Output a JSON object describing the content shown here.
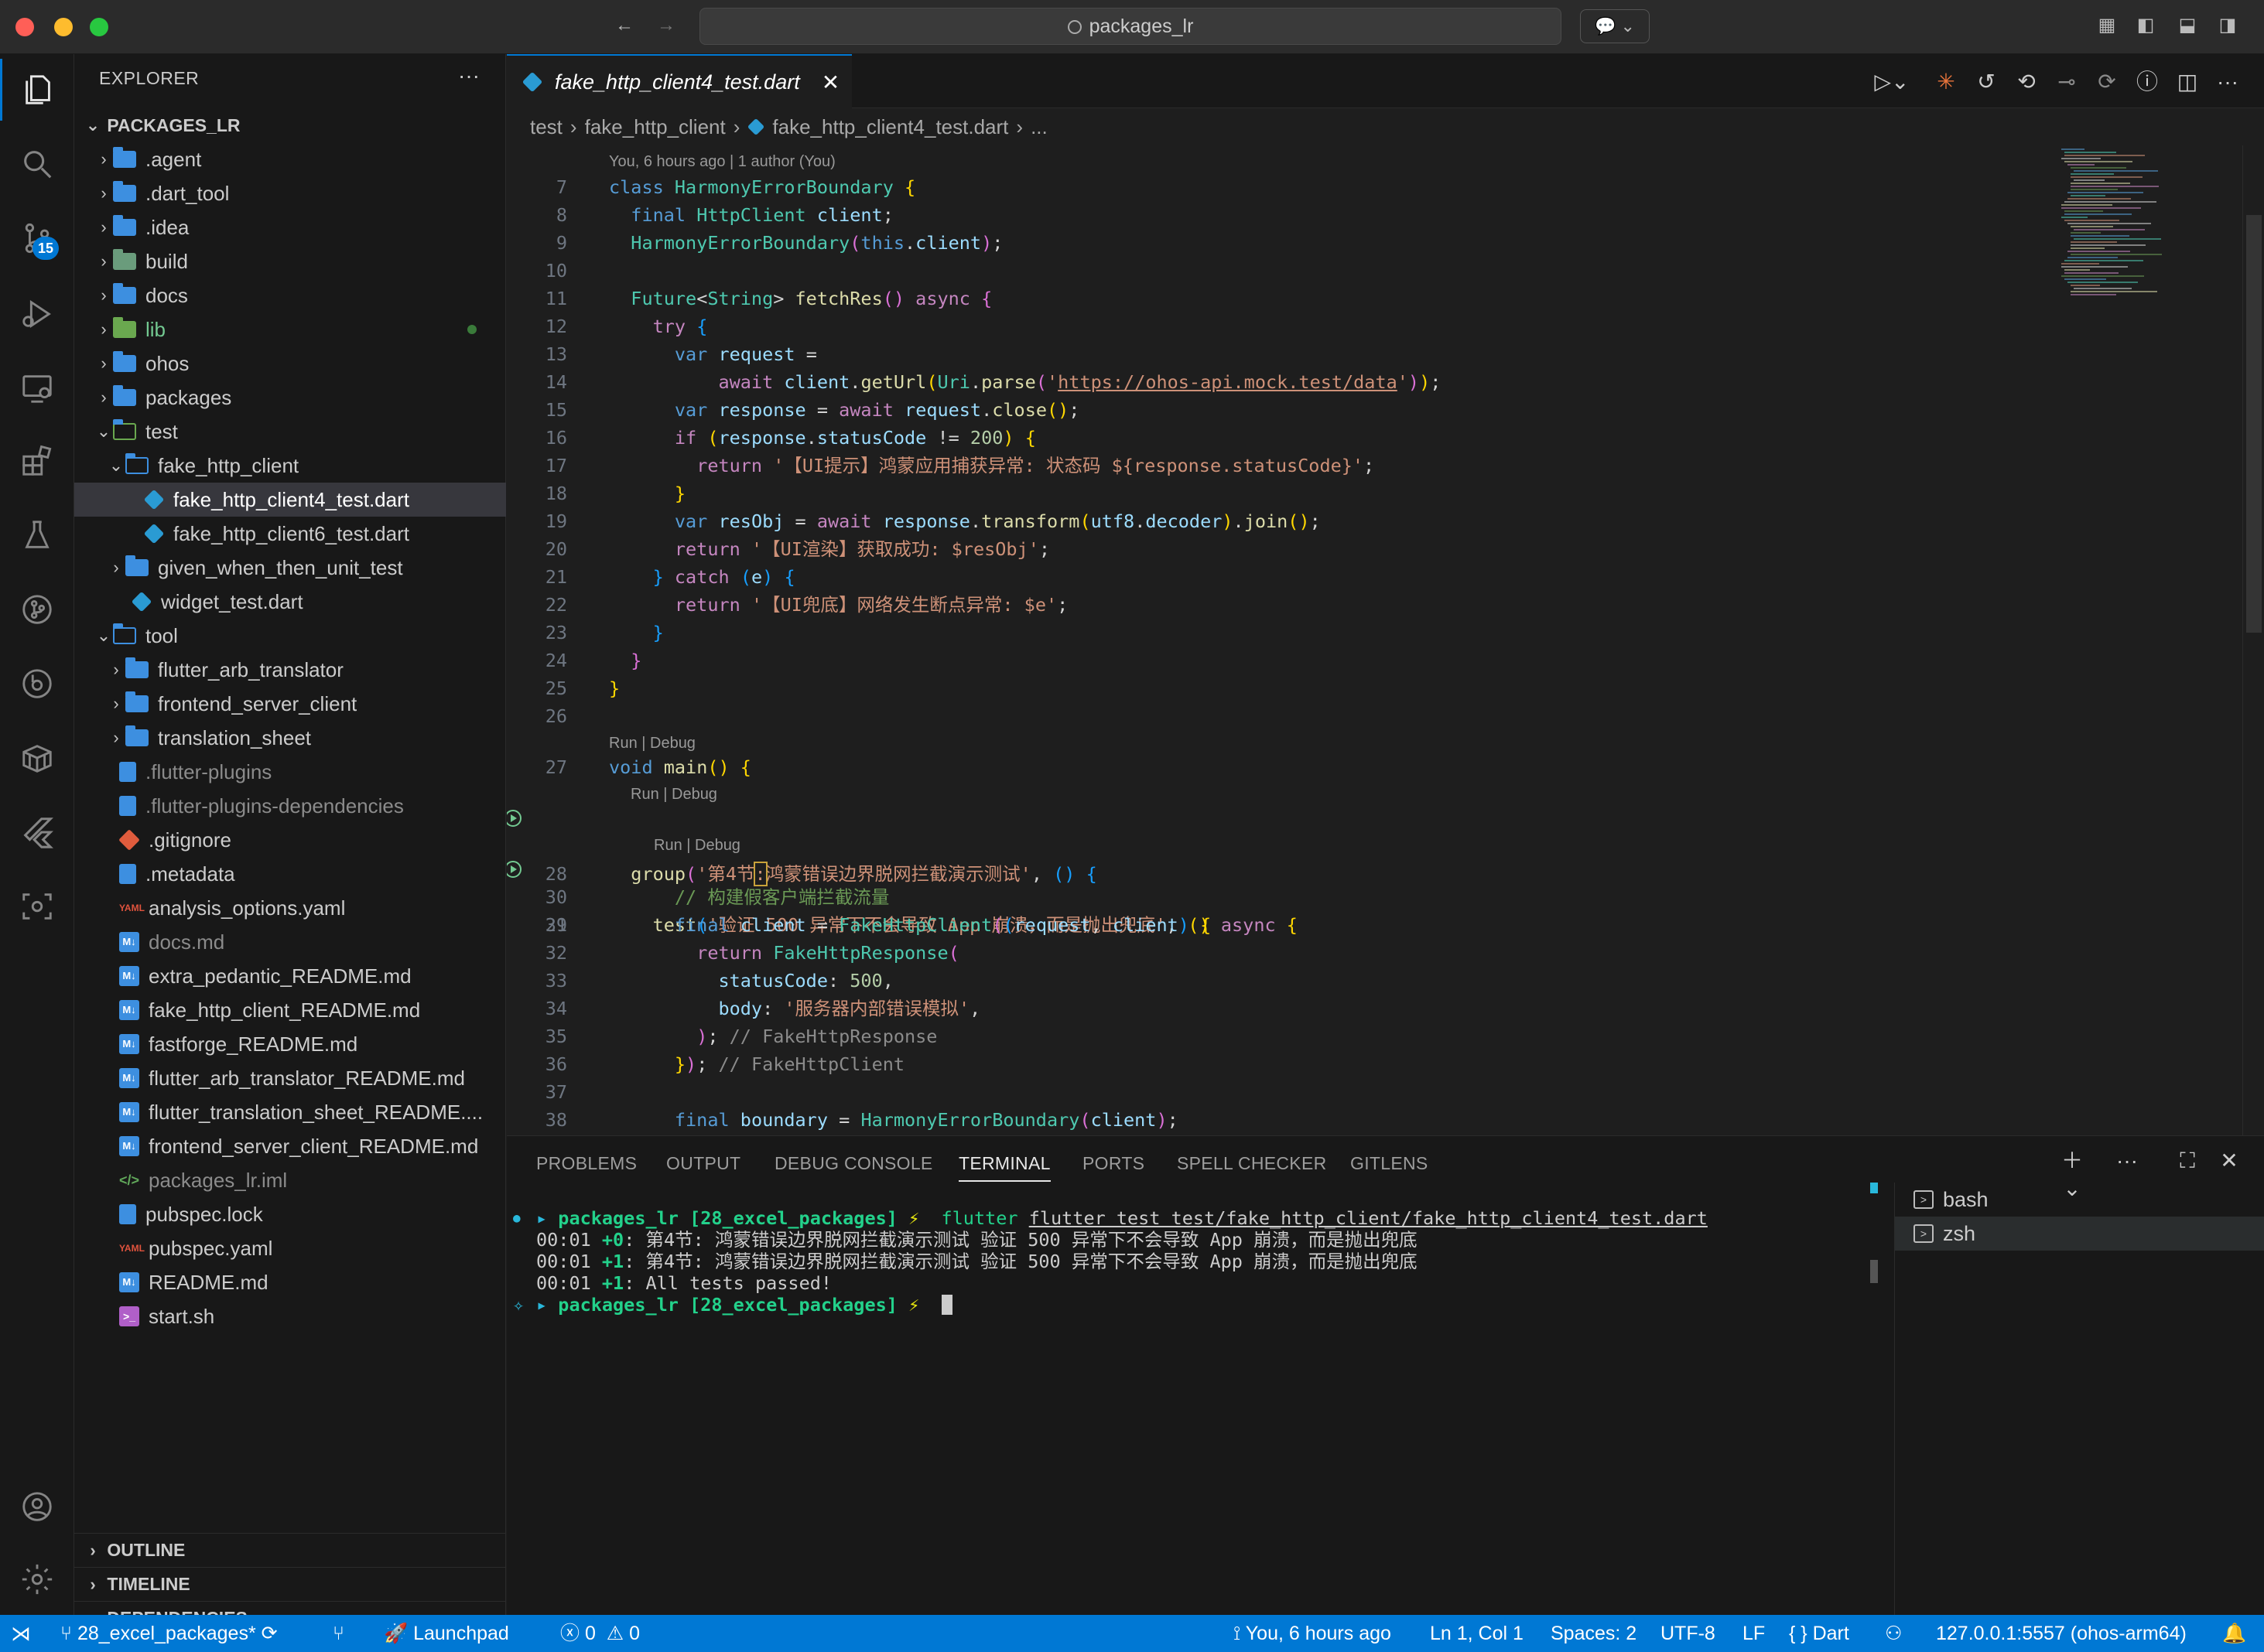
{
  "window": {
    "search_title": "packages_lr"
  },
  "activity_bar": {
    "scm_badge": "15"
  },
  "explorer": {
    "title": "EXPLORER",
    "root": "PACKAGES_LR",
    "items": [
      {
        "label": ".agent"
      },
      {
        "label": ".dart_tool"
      },
      {
        "label": ".idea"
      },
      {
        "label": "build"
      },
      {
        "label": "docs"
      },
      {
        "label": "lib"
      },
      {
        "label": "ohos"
      },
      {
        "label": "packages"
      },
      {
        "label": "test"
      },
      {
        "label": "fake_http_client"
      },
      {
        "label": "fake_http_client4_test.dart"
      },
      {
        "label": "fake_http_client6_test.dart"
      },
      {
        "label": "given_when_then_unit_test"
      },
      {
        "label": "widget_test.dart"
      },
      {
        "label": "tool"
      },
      {
        "label": "flutter_arb_translator"
      },
      {
        "label": "frontend_server_client"
      },
      {
        "label": "translation_sheet"
      },
      {
        "label": ".flutter-plugins"
      },
      {
        "label": ".flutter-plugins-dependencies"
      },
      {
        "label": ".gitignore"
      },
      {
        "label": ".metadata"
      },
      {
        "label": "analysis_options.yaml"
      },
      {
        "label": "docs.md"
      },
      {
        "label": "extra_pedantic_README.md"
      },
      {
        "label": "fake_http_client_README.md"
      },
      {
        "label": "fastforge_README.md"
      },
      {
        "label": "flutter_arb_translator_README.md"
      },
      {
        "label": "flutter_translation_sheet_README...."
      },
      {
        "label": "frontend_server_client_README.md"
      },
      {
        "label": "packages_lr.iml"
      },
      {
        "label": "pubspec.lock"
      },
      {
        "label": "pubspec.yaml"
      },
      {
        "label": "README.md"
      },
      {
        "label": "start.sh"
      }
    ],
    "sections": [
      "OUTLINE",
      "TIMELINE",
      "DEPENDENCIES"
    ]
  },
  "editor": {
    "tab_label": "fake_http_client4_test.dart",
    "breadcrumb": [
      "test",
      "fake_http_client",
      "fake_http_client4_test.dart",
      "..."
    ],
    "blame": "You, 6 hours ago | 1 author (You)",
    "codelens": "Run | Debug",
    "line_numbers": [
      "7",
      "8",
      "9",
      "10",
      "11",
      "12",
      "13",
      "14",
      "15",
      "16",
      "17",
      "18",
      "19",
      "20",
      "21",
      "22",
      "23",
      "24",
      "25",
      "26",
      "27",
      "28",
      "29",
      "30",
      "31",
      "32",
      "33",
      "34",
      "35",
      "36",
      "37",
      "38"
    ],
    "strings": {
      "url": "https://ohos-api.mock.test/data",
      "error_status": "'【UI提示】鸿蒙应用捕获异常: 状态码 ${response.statusCode}'",
      "render_ok": "'【UI渲染】获取成功: $resObj'",
      "fallback": "'【UI兜底】网络发生断点异常: $e'",
      "group_name_a": "'第4节",
      "group_name_b": ":",
      "group_name_c": "鸿蒙错误边界脱网拦截演示测试'",
      "test_name": "'验证 500 异常下不会导致 App 崩溃，而是抛出兜底'",
      "comment_fake": "// 构建假客户端拦截流量",
      "body_text": "'服务器内部错误模拟'",
      "comment_resp": "// FakeHttpResponse",
      "comment_client": "// FakeHttpClient"
    }
  },
  "panel": {
    "tabs": [
      "PROBLEMS",
      "OUTPUT",
      "DEBUG CONSOLE",
      "TERMINAL",
      "PORTS",
      "SPELL CHECKER",
      "GITLENS"
    ],
    "active_tab": "TERMINAL",
    "terminal": {
      "prompt": "packages_lr [28_excel_packages]",
      "prompt_symbol": "⚡",
      "command": "flutter test test/fake_http_client/fake_http_client4_test.dart",
      "output": [
        {
          "time": "00:01",
          "count": "+0",
          "text": ": 第4节: 鸿蒙错误边界脱网拦截演示测试 验证 500 异常下不会导致 App 崩溃，而是抛出兜底"
        },
        {
          "time": "00:01",
          "count": "+1",
          "text": ": 第4节: 鸿蒙错误边界脱网拦截演示测试 验证 500 异常下不会导致 App 崩溃，而是抛出兜底"
        },
        {
          "time": "00:01",
          "count": "+1",
          "text": ": All tests passed!"
        }
      ]
    },
    "terminals": [
      "bash",
      "zsh"
    ]
  },
  "statusbar": {
    "branch": "28_excel_packages*",
    "launchpad": "Launchpad",
    "errors": "0",
    "warnings": "0",
    "blame": "You, 6 hours ago",
    "position": "Ln 1, Col 1",
    "spaces": "Spaces: 2",
    "encoding": "UTF-8",
    "eol": "LF",
    "language": "Dart",
    "device": "127.0.0.1:5557 (ohos-arm64)"
  }
}
